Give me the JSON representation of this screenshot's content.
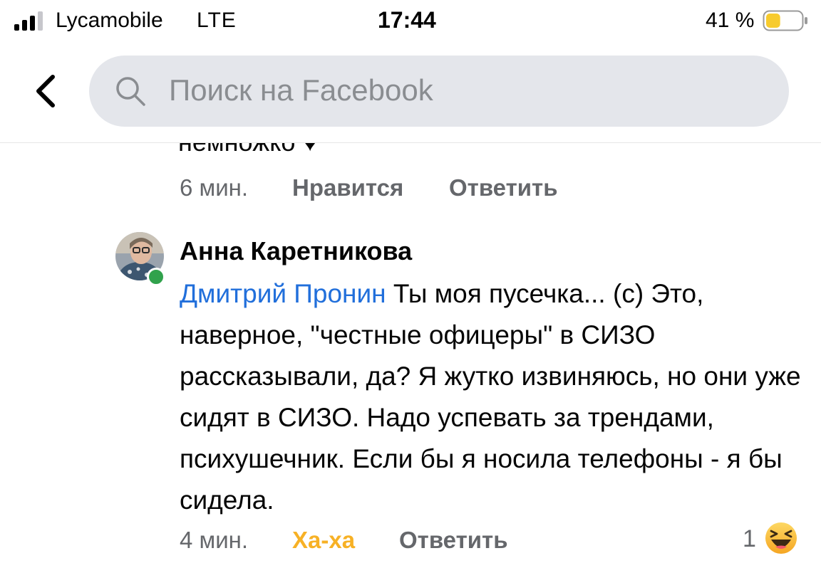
{
  "status_bar": {
    "carrier": "Lycamobile",
    "network": "LTE",
    "time": "17:44",
    "battery": "41 %",
    "battery_level": 0.41
  },
  "header": {
    "search_placeholder": "Поиск на Facebook"
  },
  "previous_comment": {
    "clipped_text": "немножко ♥",
    "time": "6 мин.",
    "like_label": "Нравится",
    "reply_label": "Ответить"
  },
  "comment": {
    "author": "Анна Каретникова",
    "mention": "Дмитрий Пронин",
    "text": " Ты моя пусечка... (с) Это, наверное, \"честные офицеры\" в СИЗО рассказывали, да? Я жутко извиняюсь, но они уже сидят в СИЗО. Надо успевать за трендами, психушечник. Если бы я носила телефоны - я бы сидела.",
    "time": "4 мин.",
    "reaction_label": "Ха-ха",
    "reply_label": "Ответить",
    "reaction_count": "1"
  },
  "colors": {
    "mention": "#216fdb",
    "haha": "#f7b125",
    "online": "#31a24c"
  }
}
